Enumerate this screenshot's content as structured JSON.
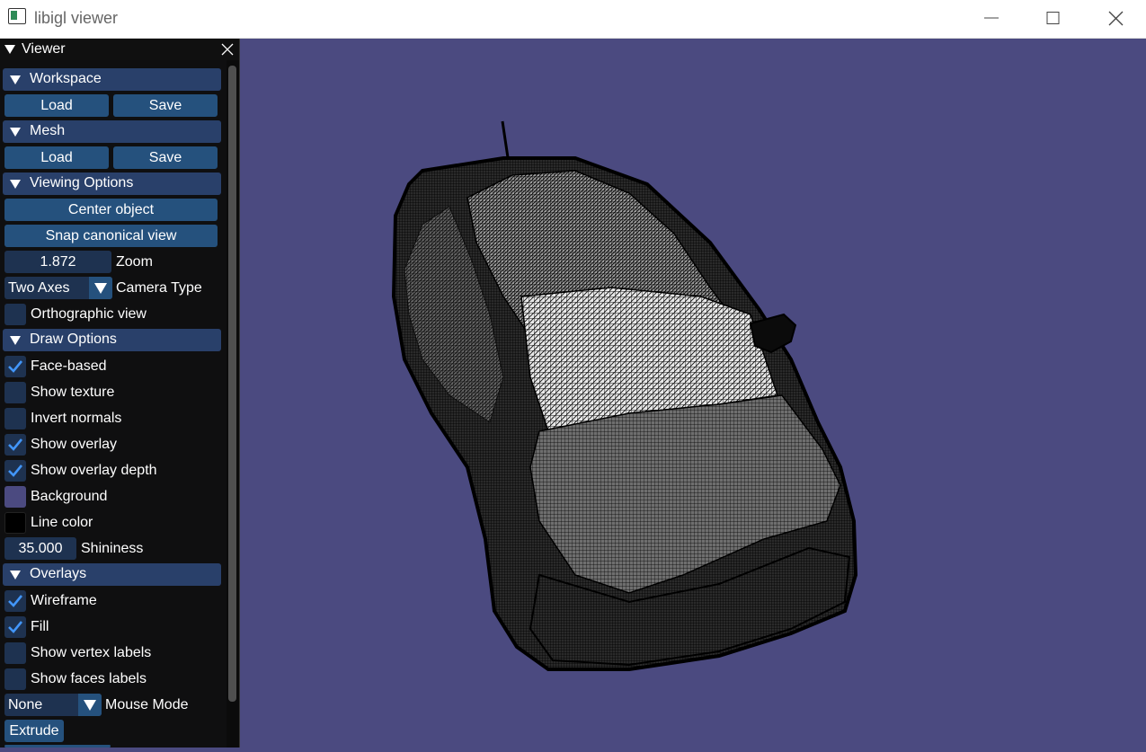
{
  "window": {
    "title": "libigl viewer",
    "icon": "app-window-icon",
    "controls": [
      "minimize-icon",
      "maximize-icon",
      "close-icon"
    ]
  },
  "panel": {
    "title": "Viewer",
    "sections": {
      "workspace": {
        "title": "Workspace",
        "load": "Load",
        "save": "Save"
      },
      "mesh": {
        "title": "Mesh",
        "load": "Load",
        "save": "Save"
      },
      "viewing": {
        "title": "Viewing Options",
        "center": "Center object",
        "snap": "Snap canonical view",
        "zoom_value": "1.872",
        "zoom_label": "Zoom",
        "camera_value": "Two Axes",
        "camera_label": "Camera Type",
        "ortho_label": "Orthographic view",
        "ortho_checked": false
      },
      "draw": {
        "title": "Draw Options",
        "items": [
          {
            "label": "Face-based",
            "checked": true
          },
          {
            "label": "Show texture",
            "checked": false
          },
          {
            "label": "Invert normals",
            "checked": false
          },
          {
            "label": "Show overlay",
            "checked": true
          },
          {
            "label": "Show overlay depth",
            "checked": true
          }
        ],
        "background_label": "Background",
        "background_color": "#4b4a80",
        "line_label": "Line color",
        "line_color": "#000000",
        "shininess_value": "35.000",
        "shininess_label": "Shininess"
      },
      "overlays": {
        "title": "Overlays",
        "items": [
          {
            "label": "Wireframe",
            "checked": true
          },
          {
            "label": "Fill",
            "checked": true
          },
          {
            "label": "Show vertex labels",
            "checked": false
          },
          {
            "label": "Show faces labels",
            "checked": false
          }
        ],
        "mouse_value": "None",
        "mouse_label": "Mouse Mode",
        "extrude": "Extrude"
      }
    }
  },
  "colors": {
    "viewport_background": "#4b4a80",
    "section_header": "#29406a",
    "button": "#25517d",
    "frame": "#1e3250",
    "check_mark": "#4296fa"
  }
}
